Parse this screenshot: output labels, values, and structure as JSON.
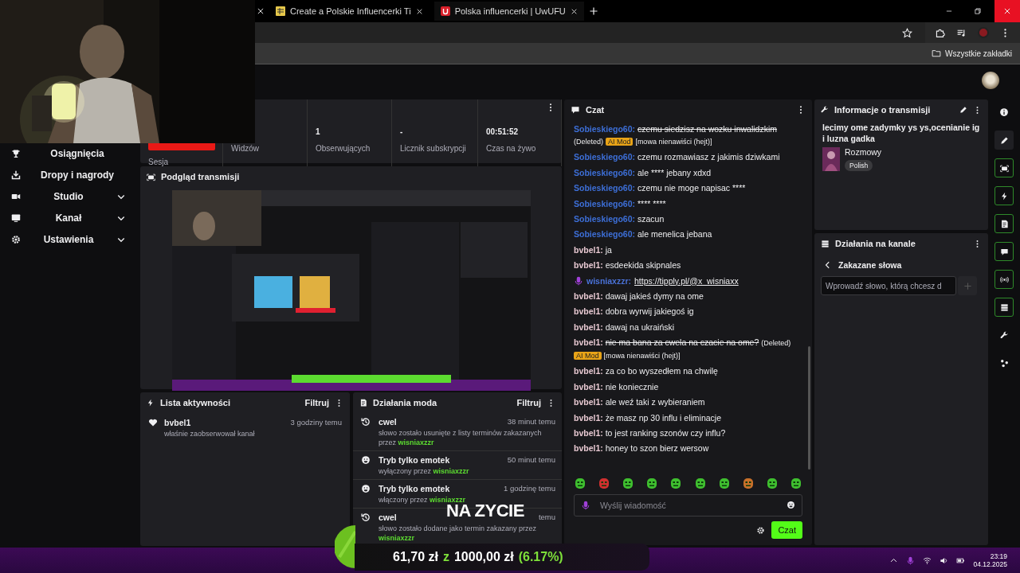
{
  "browser": {
    "tabs": [
      {
        "title": "Create a Polskie Influencerki Ti",
        "selected": false
      },
      {
        "title": "Polska influencerki | UwUFU",
        "selected": true
      }
    ],
    "bookmarks": "Wszystkie zakładki"
  },
  "sidebar": {
    "items": [
      {
        "label": "Osiągnięcia",
        "kind": "trophy",
        "has_submenu": false
      },
      {
        "label": "Dropy i nagrody",
        "kind": "drops",
        "has_submenu": false
      },
      {
        "label": "Studio",
        "kind": "studio",
        "has_submenu": true
      },
      {
        "label": "Kanał",
        "kind": "channel",
        "has_submenu": true
      },
      {
        "label": "Ustawienia",
        "kind": "settings",
        "has_submenu": true
      }
    ]
  },
  "stats": {
    "session_label": "Sesja",
    "items": [
      {
        "label": "Widzów"
      },
      {
        "value": "1",
        "label": "Obserwujących"
      },
      {
        "value": "-",
        "label": "Licznik subskrypcji"
      },
      {
        "value": "00:51:52",
        "label": "Czas na żywo"
      }
    ]
  },
  "preview": {
    "title": "Podgląd transmisji"
  },
  "activity": {
    "title": "Lista aktywności",
    "filter": "Filtruj",
    "items": [
      {
        "user": "bvbel1",
        "action": "właśnie zaobserwował kanał",
        "time": "3 godziny temu"
      }
    ]
  },
  "mod_actions": {
    "title": "Działania moda",
    "filter": "Filtruj",
    "items": [
      {
        "kind": "term",
        "title": "cwel",
        "detail": "słowo zostało usunięte z listy terminów zakazanych przez",
        "by": "wisniaxzzr",
        "time": "38 minut temu"
      },
      {
        "kind": "emote",
        "title": "Tryb tylko emotek",
        "detail": "wyłączony przez",
        "by": "wisniaxzzr",
        "time": "50 minut temu"
      },
      {
        "kind": "emote",
        "title": "Tryb tylko emotek",
        "detail": "włączony przez",
        "by": "wisniaxzzr",
        "time": "1 godzinę temu"
      },
      {
        "kind": "term",
        "title": "cwel",
        "detail": "słowo zostało dodane jako termin zakazany przez",
        "by": "wisniaxzzr",
        "time": "temu"
      }
    ]
  },
  "chat": {
    "title": "Czat",
    "placeholder": "Wyślij wiadomość",
    "send": "Czat",
    "messages": [
      {
        "kind": "removed",
        "user": "Sobieskiego60:",
        "color": "#3d6fd8",
        "text": "czemu siedzisz na wozku inwalidzkim",
        "status": "(Deleted)",
        "badge": "AI Mod",
        "reason": "[mowa nienawiści (hejt)]"
      },
      {
        "kind": "message",
        "user": "Sobieskiego60:",
        "color": "#3d6fd8",
        "text": "czemu rozmawiasz z jakimis dziwkami"
      },
      {
        "kind": "message",
        "user": "Sobieskiego60:",
        "color": "#3d6fd8",
        "text": "ale **** jebany xdxd"
      },
      {
        "kind": "message",
        "user": "Sobieskiego60:",
        "color": "#3d6fd8",
        "text": "czemu nie moge napisac ****"
      },
      {
        "kind": "message",
        "user": "Sobieskiego60:",
        "color": "#3d6fd8",
        "text": "**** ****"
      },
      {
        "kind": "message",
        "user": "Sobieskiego60:",
        "color": "#3d6fd8",
        "text": "szacun"
      },
      {
        "kind": "message",
        "user": "Sobieskiego60:",
        "color": "#3d6fd8",
        "text": "ale menelica jebana"
      },
      {
        "kind": "message",
        "user": "bvbel1:",
        "color": "#e8c9d2",
        "text": "ja"
      },
      {
        "kind": "message",
        "user": "bvbel1:",
        "color": "#e8c9d2",
        "text": "esdeekida skipnales"
      },
      {
        "kind": "link",
        "user": "wisniaxzzr:",
        "color": "#4a72d8",
        "text": "https://tipply.pl/@x_wisniaxx"
      },
      {
        "kind": "message",
        "user": "bvbel1:",
        "color": "#e8c9d2",
        "text": "dawaj jakieś dymy na ome"
      },
      {
        "kind": "message",
        "user": "bvbel1:",
        "color": "#e8c9d2",
        "text": "dobra wyrwij jakiegoś ig"
      },
      {
        "kind": "message",
        "user": "bvbel1:",
        "color": "#e8c9d2",
        "text": "dawaj na ukraiński"
      },
      {
        "kind": "removed",
        "user": "bvbel1:",
        "color": "#e8c9d2",
        "text": "nie ma bana za cwela na czacie na ome?",
        "status": "(Deleted)",
        "badge": "AI Mod",
        "reason": "[mowa nienawiści (hejt)]"
      },
      {
        "kind": "message",
        "user": "bvbel1:",
        "color": "#e8c9d2",
        "text": "za co bo wyszedłem na chwilę"
      },
      {
        "kind": "message",
        "user": "bvbel1:",
        "color": "#e8c9d2",
        "text": "nie koniecznie"
      },
      {
        "kind": "message",
        "user": "bvbel1:",
        "color": "#e8c9d2",
        "text": "ale weź taki z wybieraniem"
      },
      {
        "kind": "message",
        "user": "bvbel1:",
        "color": "#e8c9d2",
        "text": "że masz np 30 influ i eliminacje"
      },
      {
        "kind": "message",
        "user": "bvbel1:",
        "color": "#e8c9d2",
        "text": "to jest ranking szonów czy influ?"
      },
      {
        "kind": "message",
        "user": "bvbel1:",
        "color": "#e8c9d2",
        "text": "honey to szon bierz wersow"
      }
    ]
  },
  "stream_info": {
    "title": "Informacje o transmisji",
    "description": "lecimy ome zadymky ys ys,ocenianie ig i luzna gadka",
    "category": "Rozmowy",
    "tag": "Polish"
  },
  "channel_actions": {
    "title": "Działania na kanale",
    "section": "Zakazane słowa",
    "placeholder": "Wprowadź słowo, którą chcesz d"
  },
  "overlay": {
    "caption": "NA ZYCIE",
    "amount": "61,70 zł",
    "separator": "z",
    "goal": "1000,00 zł",
    "percent": "(6.17%)"
  },
  "taskbar": {
    "time": "23:19",
    "date": "04.12.2025"
  }
}
